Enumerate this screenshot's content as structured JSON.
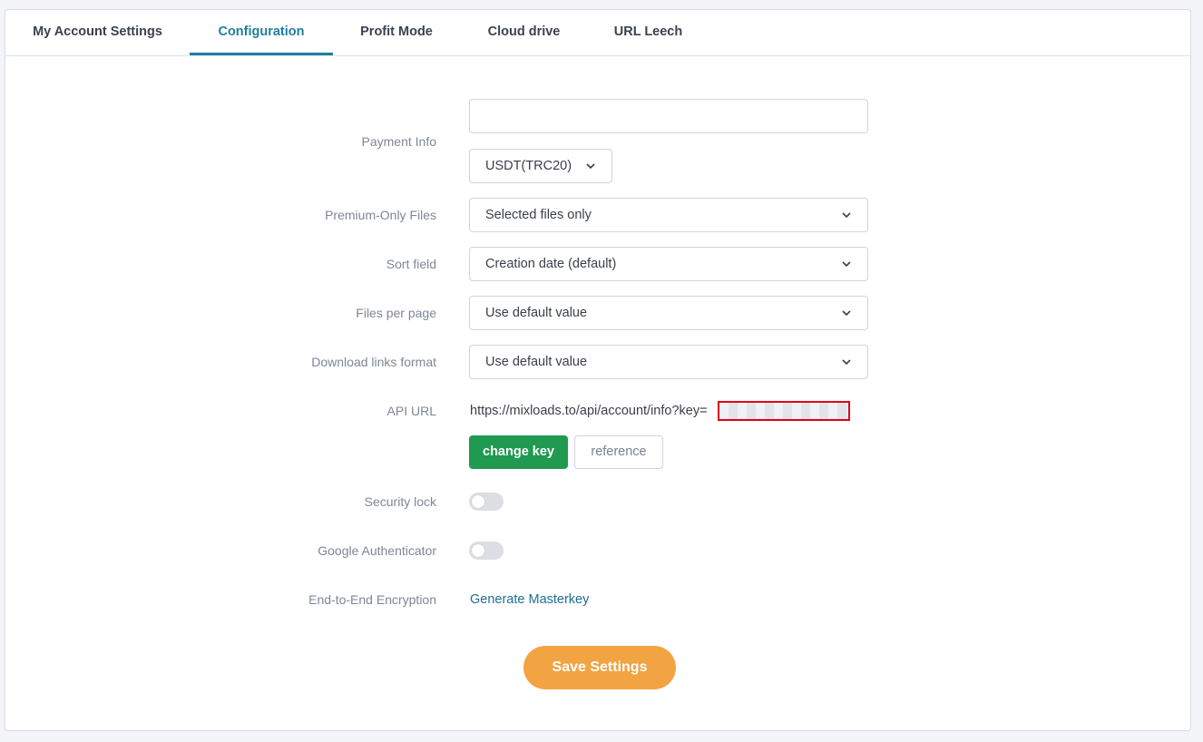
{
  "tabs": [
    {
      "label": "My Account Settings"
    },
    {
      "label": "Configuration",
      "active": true
    },
    {
      "label": "Profit Mode"
    },
    {
      "label": "Cloud drive"
    },
    {
      "label": "URL Leech"
    }
  ],
  "form": {
    "payment_info": {
      "label": "Payment Info",
      "value": "",
      "currency": "USDT(TRC20)"
    },
    "premium_only": {
      "label": "Premium-Only Files",
      "value": "Selected files only"
    },
    "sort_field": {
      "label": "Sort field",
      "value": "Creation date (default)"
    },
    "files_per_page": {
      "label": "Files per page",
      "value": "Use default value"
    },
    "download_links_format": {
      "label": "Download links format",
      "value": "Use default value"
    },
    "api_url": {
      "label": "API URL",
      "value": "https://mixloads.to/api/account/info?key=",
      "change_key_label": "change key",
      "reference_label": "reference"
    },
    "security_lock": {
      "label": "Security lock",
      "enabled": false
    },
    "google_auth": {
      "label": "Google Authenticator",
      "enabled": false
    },
    "e2e": {
      "label": "End-to-End Encryption",
      "link": "Generate Masterkey"
    }
  },
  "save_label": "Save Settings",
  "colors": {
    "accent": "#1f7ea3",
    "green": "#1f9a50",
    "orange": "#f1a441",
    "redaction_border": "#e0001b"
  },
  "icons": {
    "select_arrow": "chevron-down-icon"
  }
}
